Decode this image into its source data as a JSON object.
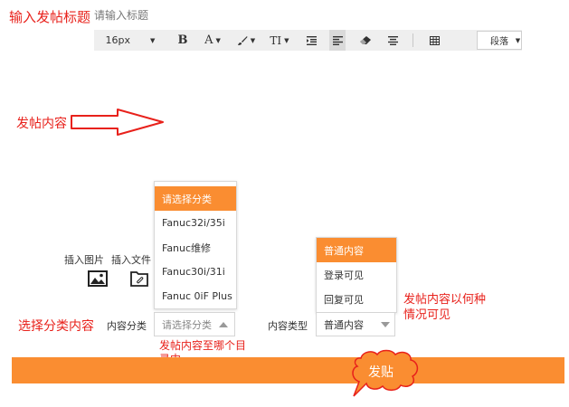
{
  "annotations": {
    "title_note": "输入发帖标题",
    "content_note": "发帖内容",
    "category_note": "选择分类内容",
    "category_hint": "发帖内容至哪个目录中",
    "visibility_hint": "发帖内容以何种情况可见",
    "submit_label": "发贴"
  },
  "title": {
    "placeholder": "请输入标题"
  },
  "toolbar": {
    "font_size": "16px",
    "bold": "B",
    "font_color": "A",
    "font_style": "TI",
    "paragraph": "段落"
  },
  "insert": {
    "image_label": "插入图片",
    "file_label": "插入文件"
  },
  "category": {
    "label": "内容分类",
    "selected": "请选择分类",
    "options": [
      "请选择分类",
      "Fanuc32i/35i",
      "Fanuc维修",
      "Fanuc30i/31i",
      "Fanuc 0iF Plus"
    ]
  },
  "content_type": {
    "label": "内容类型",
    "selected": "普通内容",
    "options": [
      "普通内容",
      "登录可见",
      "回复可见"
    ]
  },
  "colors": {
    "accent": "#fa8d31",
    "annotation": "#e8211b"
  },
  "icons": [
    "bold-icon",
    "font-color-icon",
    "brush-icon",
    "text-style-icon",
    "indent-icon",
    "align-left-icon",
    "eraser-icon",
    "align-center-icon",
    "table-icon",
    "image-icon",
    "file-icon",
    "arrow-right-icon",
    "speech-bubble-icon"
  ]
}
